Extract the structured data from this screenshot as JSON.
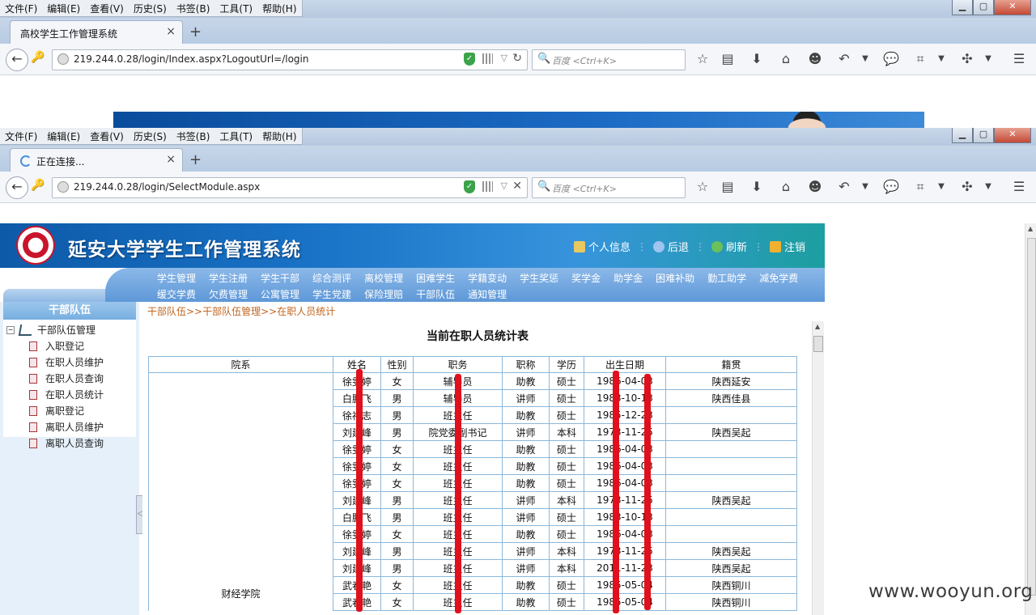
{
  "menu": [
    "文件(F)",
    "编辑(E)",
    "查看(V)",
    "历史(S)",
    "书签(B)",
    "工具(T)",
    "帮助(H)"
  ],
  "window1": {
    "tab_title": "高校学生工作管理系统",
    "url": "219.244.0.28/login/Index.aspx?LogoutUrl=/login",
    "search_placeholder": "百度 <Ctrl+K>"
  },
  "window2": {
    "tab_title": "正在连接...",
    "url": "219.244.0.28/login/SelectModule.aspx",
    "search_placeholder": "百度 <Ctrl+K>"
  },
  "app": {
    "title": "延安大学学生工作管理系统",
    "header_links": [
      "个人信息",
      "后退",
      "刷新",
      "注销"
    ],
    "nav_row1": [
      "学生管理",
      "学生注册",
      "学生干部",
      "综合测评",
      "离校管理",
      "困难学生",
      "学籍变动",
      "学生奖惩",
      "奖学金",
      "助学金",
      "困难补助",
      "勤工助学",
      "减免学费"
    ],
    "nav_row2": [
      "缓交学费",
      "欠费管理",
      "公寓管理",
      "学生党建",
      "保险理赔",
      "干部队伍",
      "通知管理"
    ]
  },
  "sidebar": {
    "header": "干部队伍",
    "root": "干部队伍管理",
    "items": [
      "入职登记",
      "在职人员维护",
      "在职人员查询",
      "在职人员统计",
      "离职登记",
      "离职人员维护",
      "离职人员查询"
    ]
  },
  "content": {
    "breadcrumb": "干部队伍>>干部队伍管理>>在职人员统计",
    "title": "当前在职人员统计表",
    "columns": [
      "院系",
      "姓名",
      "性别",
      "职务",
      "职称",
      "学历",
      "出生日期",
      "籍贯"
    ],
    "department": "财经学院",
    "rows": [
      [
        "徐雯婷",
        "女",
        "辅导员",
        "助教",
        "硕士",
        "1986-04-03",
        "陕西延安"
      ],
      [
        "白鹏飞",
        "男",
        "辅导员",
        "讲师",
        "硕士",
        "1983-10-13",
        "陕西佳县"
      ],
      [
        "徐福志",
        "男",
        "班主任",
        "助教",
        "硕士",
        "1985-12-23",
        ""
      ],
      [
        "刘建峰",
        "男",
        "院党委副书记",
        "讲师",
        "本科",
        "1973-11-25",
        "陕西吴起"
      ],
      [
        "徐雯婷",
        "女",
        "班主任",
        "助教",
        "硕士",
        "1986-04-03",
        ""
      ],
      [
        "徐雯婷",
        "女",
        "班主任",
        "助教",
        "硕士",
        "1986-04-03",
        ""
      ],
      [
        "徐雯婷",
        "女",
        "班主任",
        "助教",
        "硕士",
        "1986-04-03",
        ""
      ],
      [
        "刘建峰",
        "男",
        "班主任",
        "讲师",
        "本科",
        "1973-11-25",
        "陕西吴起"
      ],
      [
        "白鹏飞",
        "男",
        "班主任",
        "讲师",
        "硕士",
        "1983-10-13",
        ""
      ],
      [
        "徐雯婷",
        "女",
        "班主任",
        "助教",
        "硕士",
        "1986-04-03",
        ""
      ],
      [
        "刘建峰",
        "男",
        "班主任",
        "讲师",
        "本科",
        "1973-11-25",
        "陕西吴起"
      ],
      [
        "刘建峰",
        "男",
        "班主任",
        "讲师",
        "本科",
        "2011-11-23",
        "陕西吴起"
      ],
      [
        "武春艳",
        "女",
        "班主任",
        "助教",
        "硕士",
        "1985-05-04",
        "陕西铜川"
      ],
      [
        "武春艳",
        "女",
        "班主任",
        "助教",
        "硕士",
        "1985-05-04",
        "陕西铜川"
      ]
    ]
  },
  "watermark": "www.wooyun.org"
}
